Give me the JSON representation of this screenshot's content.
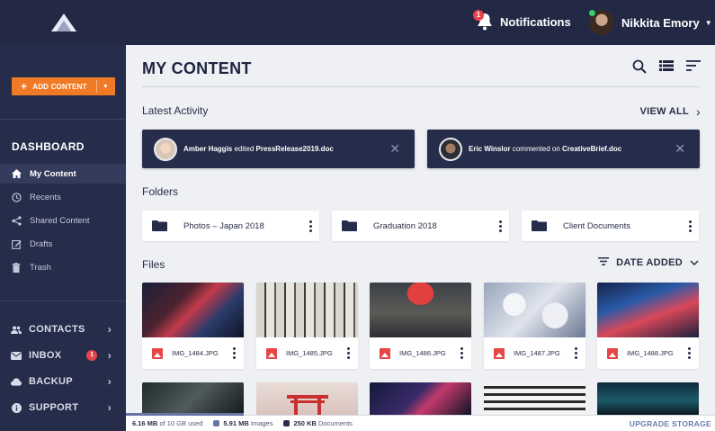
{
  "topbar": {
    "logo": "app-logo",
    "notifications_label": "Notifications",
    "notifications_count": "1",
    "user_name": "Nikkita Emory"
  },
  "sidebar": {
    "add_content_label": "ADD CONTENT",
    "dashboard_title": "DASHBOARD",
    "nav": [
      {
        "label": "My Content",
        "icon": "home-icon"
      },
      {
        "label": "Recents",
        "icon": "clock-icon"
      },
      {
        "label": "Shared Content",
        "icon": "share-icon"
      },
      {
        "label": "Drafts",
        "icon": "edit-icon"
      },
      {
        "label": "Trash",
        "icon": "trash-icon"
      }
    ],
    "sections": [
      {
        "label": "CONTACTS",
        "icon": "people-icon"
      },
      {
        "label": "INBOX",
        "icon": "mail-icon",
        "badge": "1"
      },
      {
        "label": "BACKUP",
        "icon": "cloud-icon"
      },
      {
        "label": "SUPPORT",
        "icon": "info-icon"
      }
    ]
  },
  "main": {
    "title": "MY CONTENT",
    "latest_activity_label": "Latest Activity",
    "view_all_label": "VIEW ALL",
    "activities": [
      {
        "user": "Amber Haggis",
        "action": "edited",
        "target": "PressRelease2019.doc"
      },
      {
        "user": "Eric Winslor",
        "action": "commented on",
        "target": "CreativeBrief.doc"
      }
    ],
    "folders_label": "Folders",
    "folders": [
      "Photos – Japan 2018",
      "Graduation 2018",
      "Client Documents"
    ],
    "files_label": "Files",
    "sort_label": "DATE ADDED",
    "files": [
      "IMG_1484.JPG",
      "IMG_1485.JPG",
      "IMG_1486.JPG",
      "IMG_1487.JPG",
      "IMG_1488.JPG"
    ]
  },
  "storage": {
    "used": "6.16 MB",
    "used_suffix": "of 10 GB used",
    "images": "5.91 MB",
    "images_label": "Images",
    "documents": "250 KB",
    "documents_label": "Documents",
    "upgrade_label": "UPGRADE STORAGE",
    "fill_fraction": 0.2,
    "images_color": "#6873a8",
    "documents_color": "#262d4b"
  },
  "colors": {
    "accent": "#f07a25",
    "navy": "#262d4b",
    "badge": "#e8434b"
  }
}
